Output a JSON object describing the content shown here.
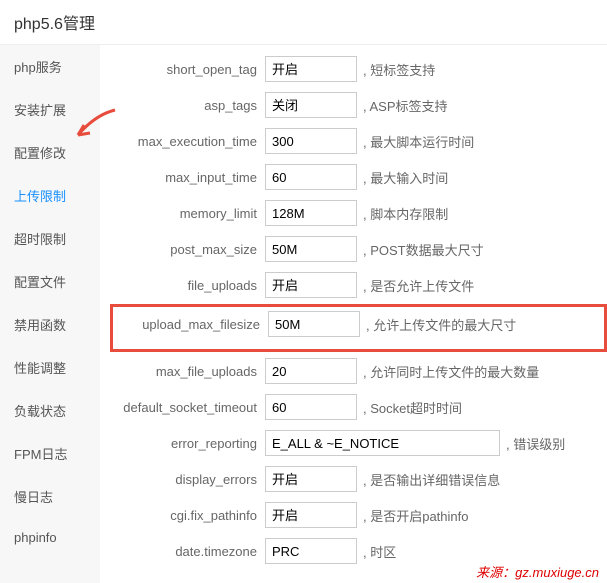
{
  "header": {
    "title": "php5.6管理"
  },
  "sidebar": {
    "items": [
      {
        "label": "php服务"
      },
      {
        "label": "安装扩展"
      },
      {
        "label": "配置修改"
      },
      {
        "label": "上传限制"
      },
      {
        "label": "超时限制"
      },
      {
        "label": "配置文件"
      },
      {
        "label": "禁用函数"
      },
      {
        "label": "性能调整"
      },
      {
        "label": "负载状态"
      },
      {
        "label": "FPM日志"
      },
      {
        "label": "慢日志"
      },
      {
        "label": "phpinfo"
      }
    ]
  },
  "settings": [
    {
      "key": "short_open_tag",
      "type": "select",
      "value": "开启",
      "desc": ", 短标签支持"
    },
    {
      "key": "asp_tags",
      "type": "select",
      "value": "关闭",
      "desc": ", ASP标签支持"
    },
    {
      "key": "max_execution_time",
      "type": "input",
      "value": "300",
      "desc": ", 最大脚本运行时间"
    },
    {
      "key": "max_input_time",
      "type": "input",
      "value": "60",
      "desc": ", 最大输入时间"
    },
    {
      "key": "memory_limit",
      "type": "input",
      "value": "128M",
      "desc": ", 脚本内存限制"
    },
    {
      "key": "post_max_size",
      "type": "input",
      "value": "50M",
      "desc": ", POST数据最大尺寸"
    },
    {
      "key": "file_uploads",
      "type": "select",
      "value": "开启",
      "desc": ", 是否允许上传文件"
    },
    {
      "key": "upload_max_filesize",
      "type": "input",
      "value": "50M",
      "desc": ", 允许上传文件的最大尺寸",
      "highlighted": true
    },
    {
      "key": "max_file_uploads",
      "type": "input",
      "value": "20",
      "desc": ", 允许同时上传文件的最大数量"
    },
    {
      "key": "default_socket_timeout",
      "type": "input",
      "value": "60",
      "desc": ", Socket超时时间"
    },
    {
      "key": "error_reporting",
      "type": "input",
      "value": "E_ALL & ~E_NOTICE",
      "desc": ", 错误级别",
      "wide": true
    },
    {
      "key": "display_errors",
      "type": "select",
      "value": "开启",
      "desc": ", 是否输出详细错误信息"
    },
    {
      "key": "cgi.fix_pathinfo",
      "type": "select",
      "value": "开启",
      "desc": ", 是否开启pathinfo"
    },
    {
      "key": "date.timezone",
      "type": "input",
      "value": "PRC",
      "desc": ", 时区"
    }
  ],
  "watermark": "来源：gz.muxiuge.cn"
}
